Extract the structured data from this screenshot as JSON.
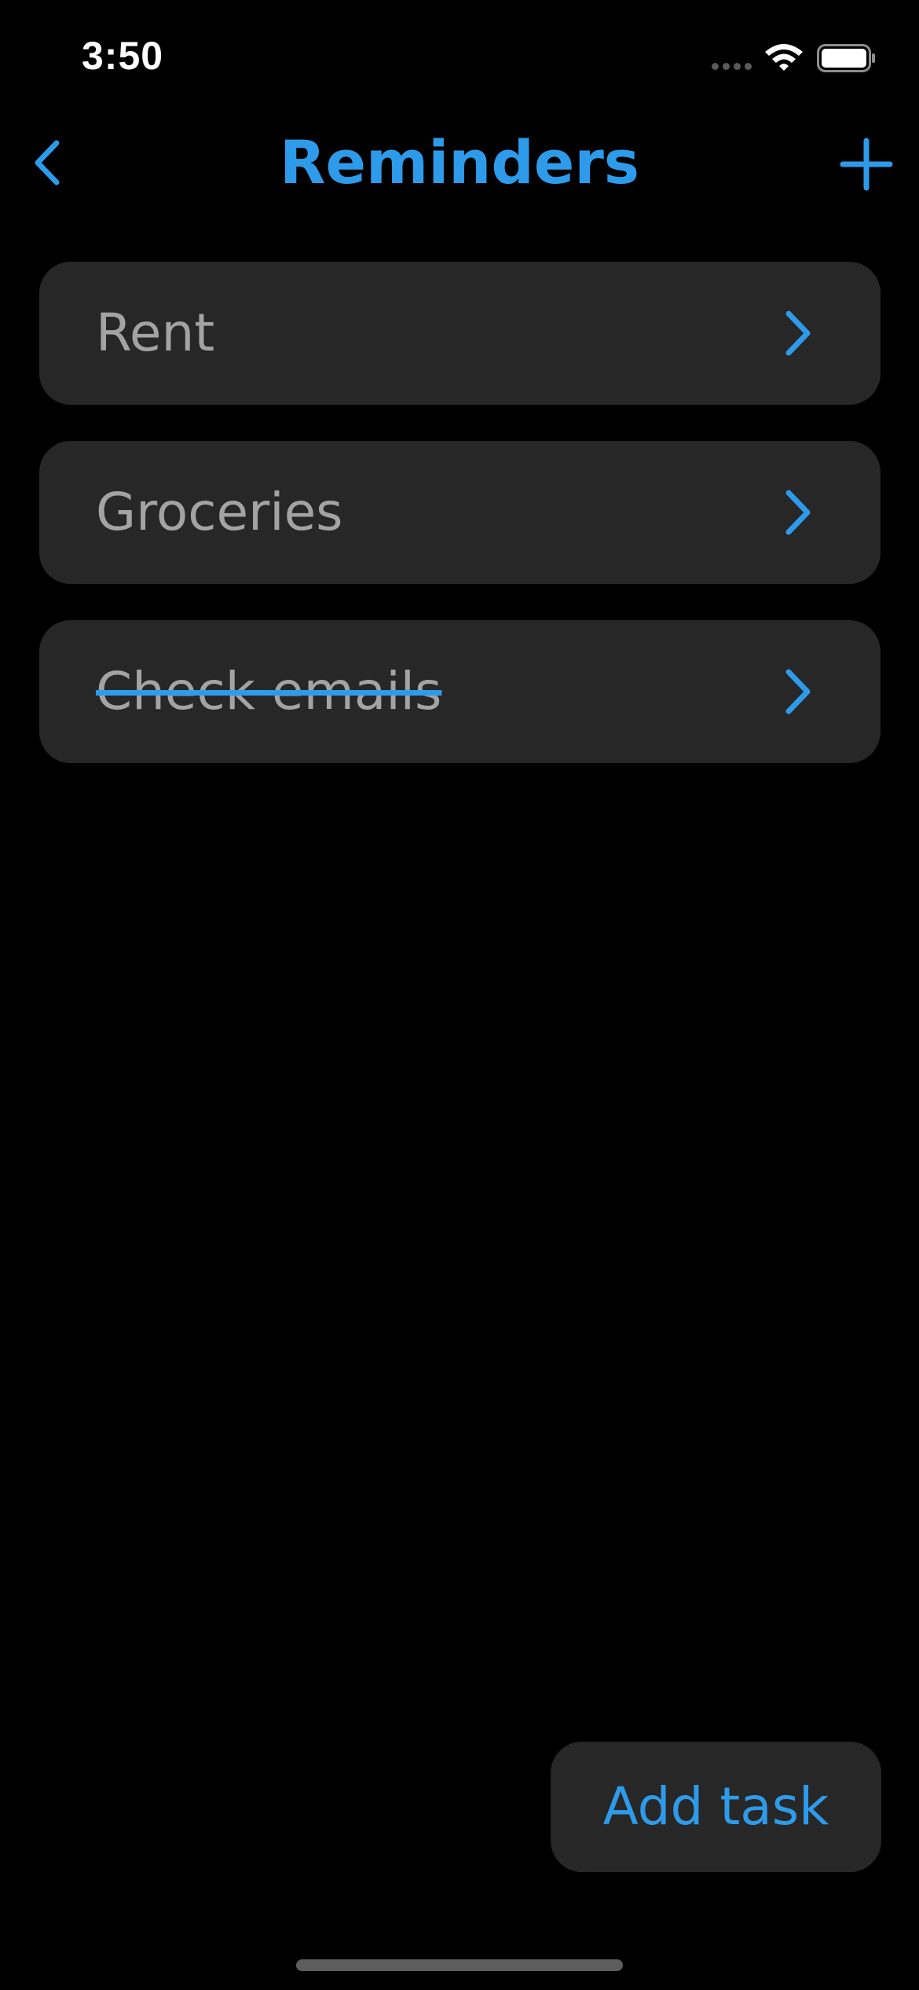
{
  "status_bar": {
    "time": "3:50",
    "icons": [
      "signal-icon",
      "wifi-icon",
      "battery-icon"
    ]
  },
  "nav": {
    "title": "Reminders",
    "back_icon": "chevron-left-icon",
    "add_icon": "plus-icon"
  },
  "tasks": [
    {
      "label": "Rent",
      "completed": false,
      "icon": "chevron-right-icon"
    },
    {
      "label": "Groceries",
      "completed": false,
      "icon": "chevron-right-icon"
    },
    {
      "label": "Check emails",
      "completed": true,
      "icon": "chevron-right-icon"
    }
  ],
  "footer": {
    "add_task_label": "Add task"
  },
  "colors": {
    "accent": "#2e9bea",
    "background": "#000000",
    "card": "#272727",
    "text_muted": "#a3a3a3"
  }
}
